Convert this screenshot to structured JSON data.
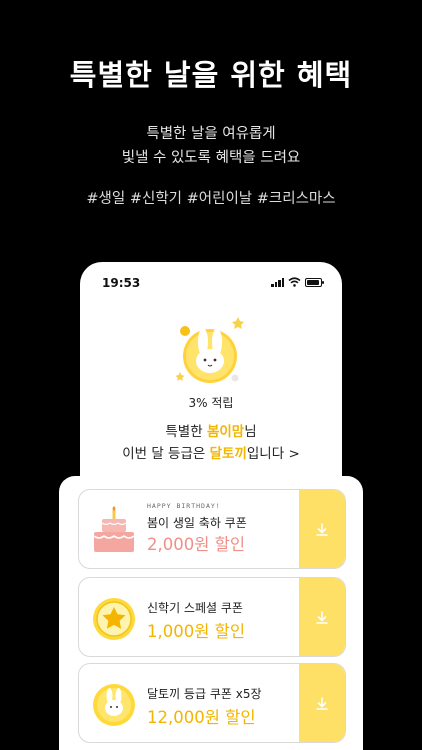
{
  "promo": {
    "headline": "특별한 날을 위한 혜택",
    "subtitle_line1": "특별한 날을 여유롭게",
    "subtitle_line2": "빛낼 수 있도록 혜택을 드려요",
    "hashtags": "#생일 #신학기 #어린이날 #크리스마스"
  },
  "phone": {
    "status_time": "19:53",
    "reward_text": "3% 적립",
    "greeting": {
      "prefix": "특별한 ",
      "user_name": "봄이맘",
      "suffix": "님"
    },
    "grade": {
      "prefix": "이번 달 등급은 ",
      "grade_name": "달토끼",
      "suffix": "입니다 >"
    }
  },
  "coupons": [
    {
      "kicker": "HAPPY BIRTHDAY!",
      "name": "봄이 생일 축하 쿠폰",
      "discount": "2,000원 할인",
      "icon": "birthday-cake-icon"
    },
    {
      "name": "신학기 스페셜 쿠폰",
      "discount": "1,000원 할인",
      "icon": "star-medal-icon"
    },
    {
      "name": "달토끼 등급 쿠폰 x5장",
      "discount": "12,000원 할인",
      "icon": "rabbit-medal-icon"
    }
  ],
  "colors": {
    "background": "#000000",
    "accent_yellow": "#ffe066",
    "highlight_text": "#f2b705",
    "birthday_price": "#f08f88"
  }
}
